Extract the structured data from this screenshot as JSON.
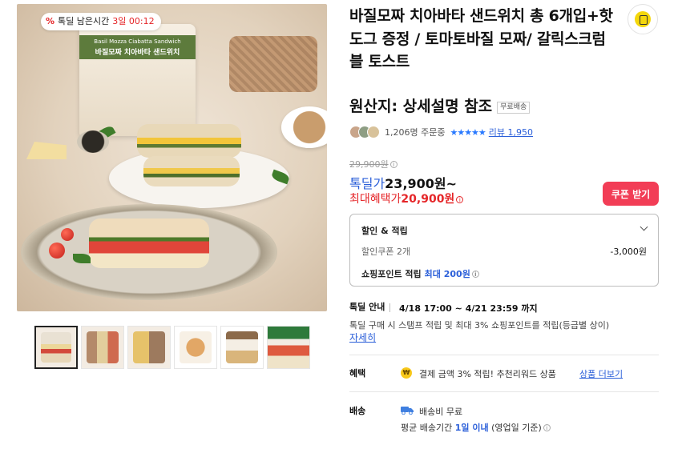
{
  "gallery": {
    "timer_badge": {
      "percent_icon": "%",
      "label": "톡딜 남은시간",
      "time": "3일 00:12"
    },
    "package_text": {
      "english": "Basil Mozza Ciabatta Sandwich",
      "korean": "바질모짜 치아바타 샌드위치"
    },
    "thumbnail_count": 6,
    "active_thumbnail": 1
  },
  "product": {
    "title": "바질모짜 치아바타 샌드위치 총 6개입+핫도그 증정 / 토마토바질 모짜/ 갈릭스크럼블 토스트",
    "origin": "원산지: 상세설명 참조",
    "free_shipping_tag": "무료배송",
    "store_icon": "store-icon"
  },
  "social": {
    "orders_text": "1,206명 주문중",
    "stars": "★★★★★",
    "review_link": "리뷰 1,950"
  },
  "price": {
    "original": "29,900원",
    "deal_label": "톡딜가",
    "deal_value": "23,900원~",
    "max_benefit_label": "최대혜택가",
    "max_benefit_value": "20,900원",
    "info_icon": "i"
  },
  "coupon_button": {
    "label": "쿠폰 받기"
  },
  "discount_box": {
    "title": "할인 & 적립",
    "coupon_label": "할인쿠폰 2개",
    "coupon_amount": "-3,000원",
    "point_label": "쇼핑포인트 적립",
    "point_value": "최대 200원"
  },
  "deal_guide": {
    "label": "톡딜 안내",
    "period": "4/18 17:00 ~ 4/21 23:59 까지",
    "description": "톡딜 구매 시 스탬프 적립 및 최대 3% 쇼핑포인트를 적립(등급별 상이)",
    "detail_link": "자세히"
  },
  "benefit": {
    "label": "혜택",
    "icon_text": "₩",
    "text": "결제 금액 3% 적립! 추천리워드 상품",
    "link": "상품 더보기"
  },
  "shipping": {
    "label": "배송",
    "fee": "배송비 무료",
    "period_prefix": "평균 배송기간",
    "period_strong": "1일 이내",
    "period_suffix": "(영업일 기준)"
  },
  "colors": {
    "accent_red": "#e52528",
    "coupon_button": "#f23d56",
    "link_blue": "#2b5fd9",
    "star_blue": "#2979ff"
  }
}
